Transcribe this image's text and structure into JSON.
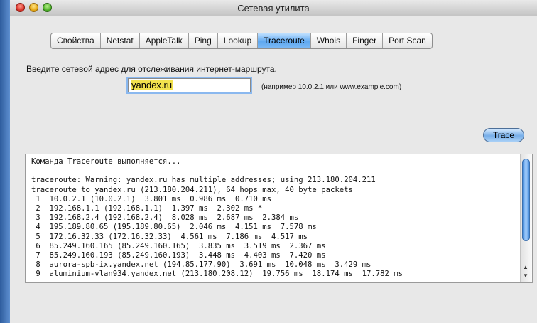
{
  "window": {
    "title": "Сетевая утилита"
  },
  "tabs": [
    {
      "label": "Свойства"
    },
    {
      "label": "Netstat"
    },
    {
      "label": "AppleTalk"
    },
    {
      "label": "Ping"
    },
    {
      "label": "Lookup"
    },
    {
      "label": "Traceroute",
      "active": true
    },
    {
      "label": "Whois"
    },
    {
      "label": "Finger"
    },
    {
      "label": "Port Scan"
    }
  ],
  "traceroute": {
    "prompt": "Введите сетевой адрес для отслеживания интернет-маршрута.",
    "address_value": "yandex.ru",
    "example": "(например 10.0.2.1 или www.example.com)",
    "trace_button": "Trace",
    "output_lines": [
      "Команда Traceroute выполняется...",
      "",
      "traceroute: Warning: yandex.ru has multiple addresses; using 213.180.204.211",
      "traceroute to yandex.ru (213.180.204.211), 64 hops max, 40 byte packets",
      " 1  10.0.2.1 (10.0.2.1)  3.801 ms  0.986 ms  0.710 ms",
      " 2  192.168.1.1 (192.168.1.1)  1.397 ms  2.302 ms *",
      " 3  192.168.2.4 (192.168.2.4)  8.028 ms  2.687 ms  2.384 ms",
      " 4  195.189.80.65 (195.189.80.65)  2.046 ms  4.151 ms  7.578 ms",
      " 5  172.16.32.33 (172.16.32.33)  4.561 ms  7.186 ms  4.517 ms",
      " 6  85.249.160.165 (85.249.160.165)  3.835 ms  3.519 ms  2.367 ms",
      " 7  85.249.160.193 (85.249.160.193)  3.448 ms  4.403 ms  7.420 ms",
      " 8  aurora-spb-ix.yandex.net (194.85.177.90)  3.691 ms  10.048 ms  3.429 ms",
      " 9  aluminium-vlan934.yandex.net (213.180.208.12)  19.756 ms  18.174 ms  17.782 ms"
    ]
  }
}
